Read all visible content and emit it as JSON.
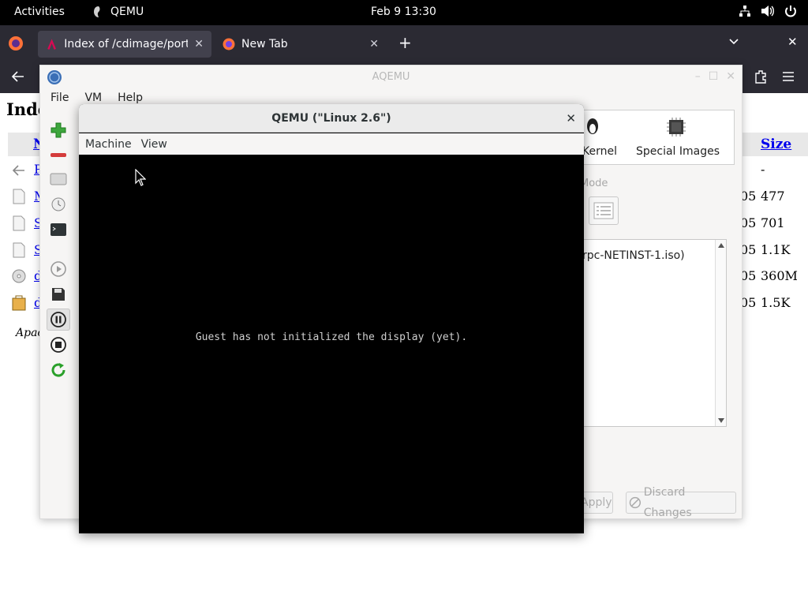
{
  "topbar": {
    "activities": "Activities",
    "app_name": "QEMU",
    "clock": "Feb 9  13:30"
  },
  "firefox": {
    "tabs": [
      {
        "label": "Index of /cdimage/ports/",
        "icon": "debian-icon"
      },
      {
        "label": "New Tab",
        "icon": "firefox-icon"
      }
    ],
    "page": {
      "heading": "Inde",
      "column_name": "N",
      "column_size": "Size",
      "rows": [
        {
          "name": "P",
          "date": "",
          "size": "-"
        },
        {
          "name": "M",
          "date": "05",
          "size": "477"
        },
        {
          "name": "S",
          "date": "05",
          "size": "701"
        },
        {
          "name": "S",
          "date": "05",
          "size": "1.1K"
        },
        {
          "name": "d",
          "date": "05",
          "size": "360M"
        },
        {
          "name": "d",
          "date": "05",
          "size": "1.5K"
        }
      ],
      "footer": "Apac"
    }
  },
  "aqemu": {
    "title": "AQEMU",
    "menu": [
      "File",
      "VM",
      "Help"
    ],
    "tabs": {
      "kernel": "Kernel",
      "special_images": "Special Images"
    },
    "mode_label": "Mode",
    "list_item": "rpc-NETINST-1.iso)",
    "apply_label": "Apply",
    "discard_label": "Discard Changes"
  },
  "qemu": {
    "title": "QEMU (\"Linux 2.6\")",
    "menu": [
      "Machine",
      "View"
    ],
    "message": "Guest has not initialized the display (yet)."
  }
}
